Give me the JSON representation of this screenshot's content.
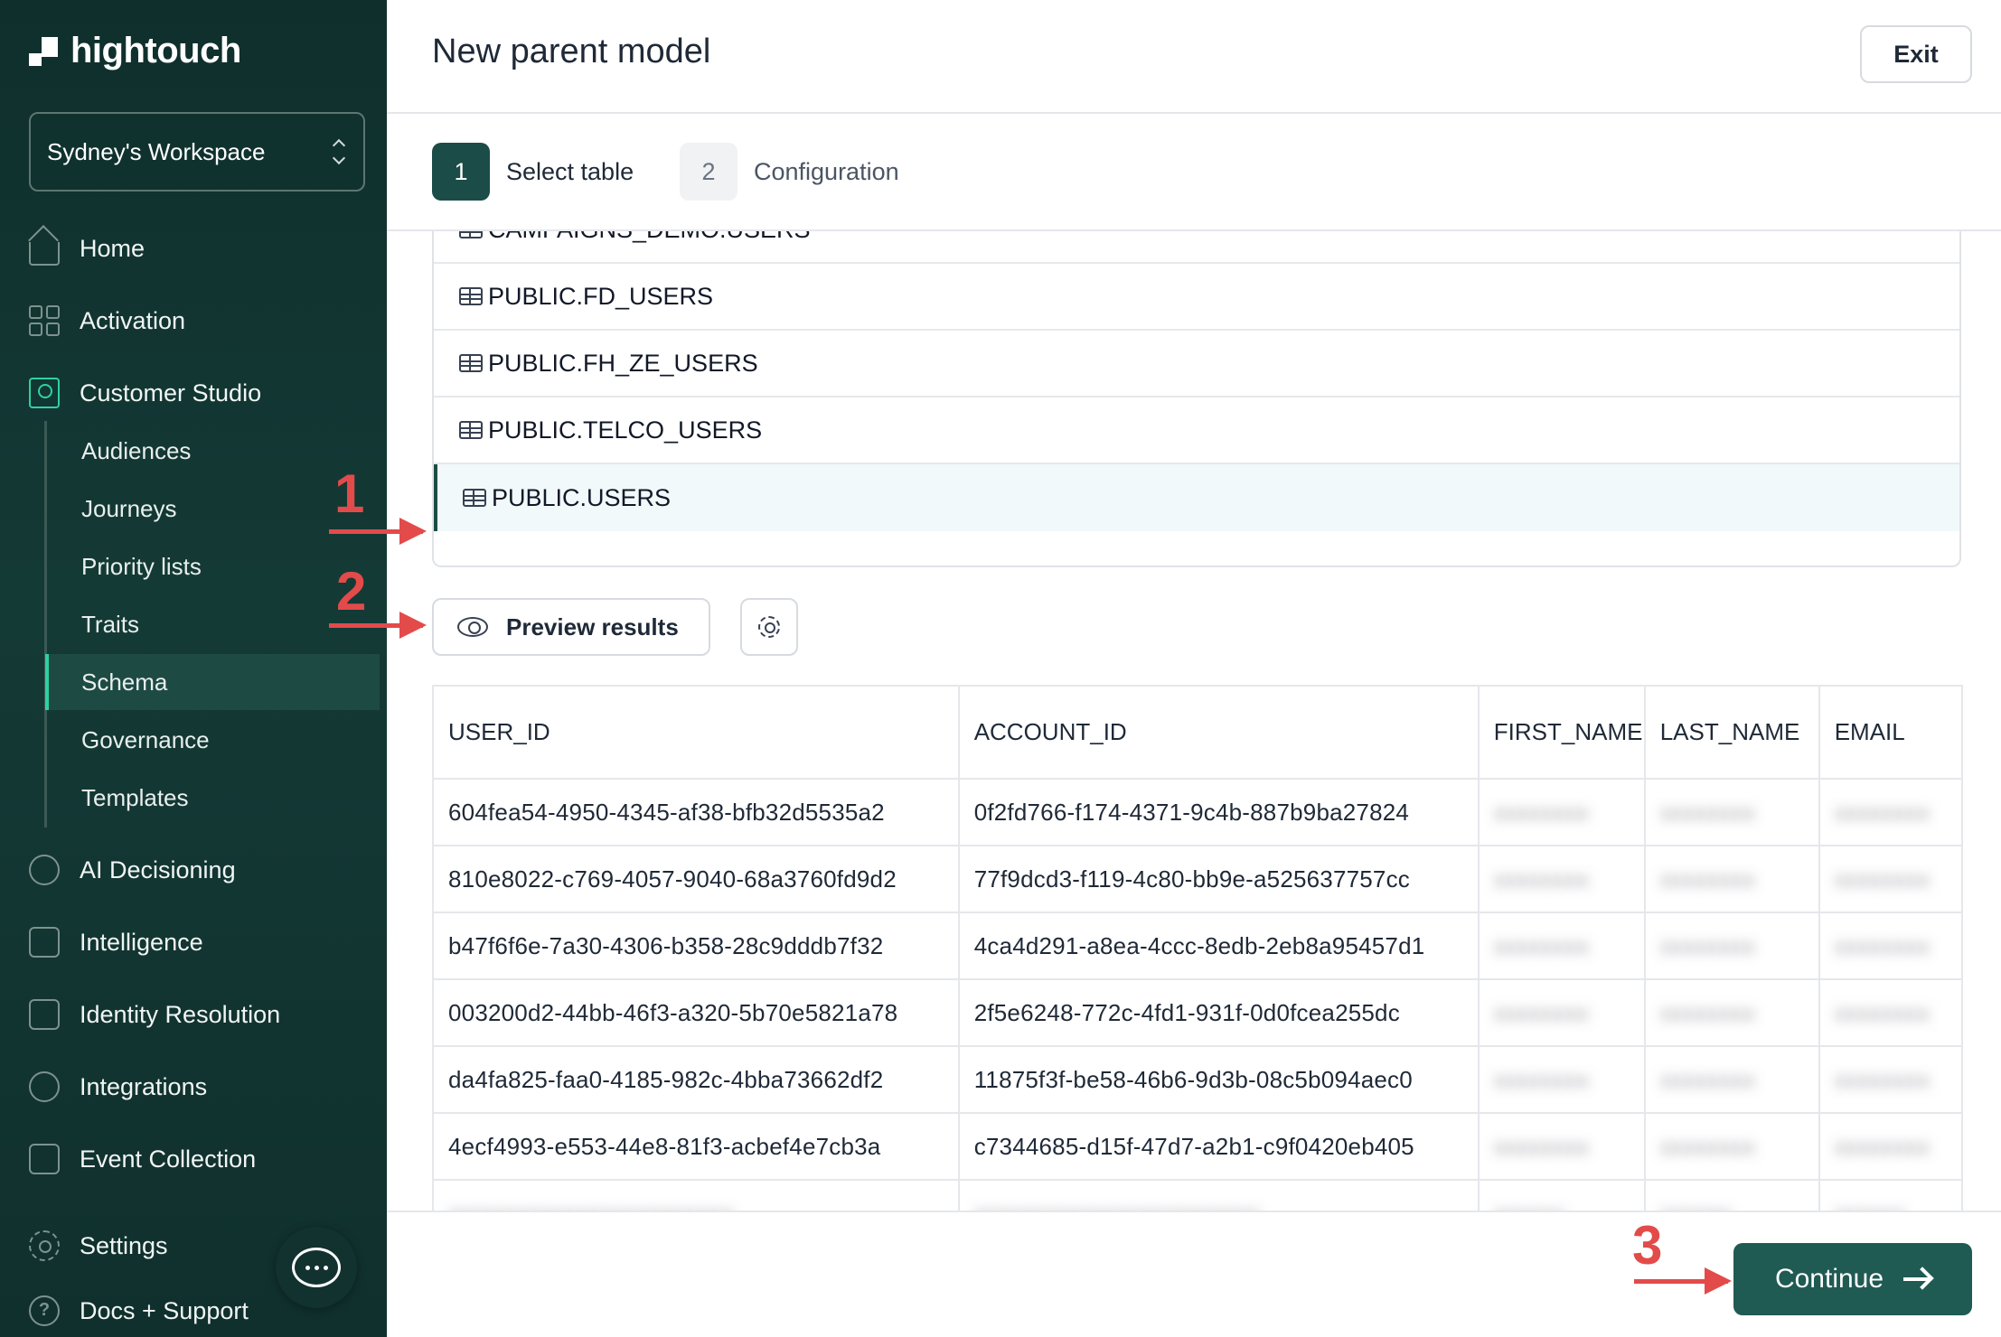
{
  "brand": {
    "name": "hightouch"
  },
  "workspace": {
    "name": "Sydney's Workspace"
  },
  "nav": {
    "home": "Home",
    "activation": "Activation",
    "customer_studio": "Customer Studio",
    "sub": [
      "Audiences",
      "Journeys",
      "Priority lists",
      "Traits",
      "Schema",
      "Governance",
      "Templates"
    ],
    "ai_decisioning": "AI Decisioning",
    "intelligence": "Intelligence",
    "identity_resolution": "Identity Resolution",
    "integrations": "Integrations",
    "event_collection": "Event Collection",
    "settings": "Settings",
    "docs_support": "Docs + Support"
  },
  "header": {
    "title": "New parent model",
    "exit_label": "Exit"
  },
  "steps": [
    {
      "number": "1",
      "label": "Select table"
    },
    {
      "number": "2",
      "label": "Configuration"
    }
  ],
  "tables": [
    "CAMPAIGNS_DEMO.USERS",
    "PUBLIC.FD_USERS",
    "PUBLIC.FH_ZE_USERS",
    "PUBLIC.TELCO_USERS",
    "PUBLIC.USERS"
  ],
  "selected_table": "PUBLIC.USERS",
  "preview": {
    "label": "Preview results"
  },
  "results": {
    "columns": [
      "USER_ID",
      "ACCOUNT_ID",
      "FIRST_NAME",
      "LAST_NAME",
      "EMAIL"
    ],
    "rows": [
      {
        "user_id": "604fea54-4950-4345-af38-bfb32d5535a2",
        "account_id": "0f2fd766-f174-4371-9c4b-887b9ba27824"
      },
      {
        "user_id": "810e8022-c769-4057-9040-68a3760fd9d2",
        "account_id": "77f9dcd3-f119-4c80-bb9e-a525637757cc"
      },
      {
        "user_id": "b47f6f6e-7a30-4306-b358-28c9dddb7f32",
        "account_id": "4ca4d291-a8ea-4ccc-8edb-2eb8a95457d1"
      },
      {
        "user_id": "003200d2-44bb-46f3-a320-5b70e5821a78",
        "account_id": "2f5e6248-772c-4fd1-931f-0d0fcea255dc"
      },
      {
        "user_id": "da4fa825-faa0-4185-982c-4bba73662df2",
        "account_id": "11875f3f-be58-46b6-9d3b-08c5b094aec0"
      },
      {
        "user_id": "4ecf4993-e553-44e8-81f3-acbef4e7cb3a",
        "account_id": "c7344685-d15f-47d7-a2b1-c9f0420eb405"
      }
    ]
  },
  "footer": {
    "continue_label": "Continue"
  },
  "annotations": [
    "1",
    "2",
    "3"
  ],
  "colors": {
    "sidebar": "#10302d",
    "accent": "#1f5a53",
    "annotation": "#e24b4a",
    "active_icon": "#2fd1a4"
  }
}
